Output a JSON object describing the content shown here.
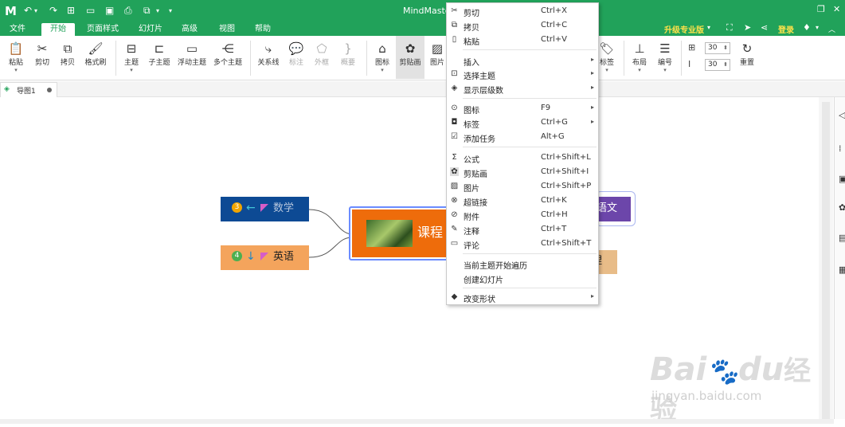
{
  "app": {
    "title": "MindMaster",
    "logo": "M"
  },
  "titlebar": {
    "upgrade_label": "升级专业版",
    "login_label": "登录"
  },
  "tabs": [
    {
      "label": "文件"
    },
    {
      "label": "开始"
    },
    {
      "label": "页面样式"
    },
    {
      "label": "幻灯片"
    },
    {
      "label": "高级"
    },
    {
      "label": "视图"
    },
    {
      "label": "帮助"
    }
  ],
  "ribbon": {
    "buttons": [
      {
        "label": "粘贴",
        "icon": "clipboard-icon"
      },
      {
        "label": "剪切",
        "icon": "scissors-icon"
      },
      {
        "label": "拷贝",
        "icon": "copy-icon"
      },
      {
        "label": "格式刷",
        "icon": "format-brush-icon"
      },
      {
        "label": "主题",
        "icon": "topic-icon"
      },
      {
        "label": "子主题",
        "icon": "subtopic-icon"
      },
      {
        "label": "浮动主题",
        "icon": "floating-topic-icon"
      },
      {
        "label": "多个主题",
        "icon": "multiple-topics-icon"
      },
      {
        "label": "关系线",
        "icon": "relationship-icon"
      },
      {
        "label": "标注",
        "icon": "callout-icon"
      },
      {
        "label": "外框",
        "icon": "boundary-icon"
      },
      {
        "label": "概要",
        "icon": "summary-icon"
      },
      {
        "label": "图标",
        "icon": "icon-icon"
      },
      {
        "label": "剪贴画",
        "icon": "clipart-icon"
      },
      {
        "label": "图片",
        "icon": "picture-icon"
      },
      {
        "label": "标签",
        "icon": "tag-icon"
      },
      {
        "label": "布局",
        "icon": "layout-icon"
      },
      {
        "label": "编号",
        "icon": "numbering-icon"
      },
      {
        "label": "重置",
        "icon": "reset-icon"
      }
    ],
    "spacing_h": "30",
    "spacing_v": "30"
  },
  "doc_tab": {
    "label": "导图1"
  },
  "mindmap": {
    "central": "课程",
    "left_topics": [
      {
        "label": "数学",
        "badge": "3",
        "badge_color": "#f0a500",
        "arrow": "←"
      },
      {
        "label": "英语",
        "badge": "4",
        "badge_color": "#4caf50",
        "arrow": "↓"
      }
    ],
    "right_topics": [
      {
        "label": "语文"
      },
      {
        "label": "理"
      }
    ]
  },
  "context_menu": {
    "items": [
      {
        "label": "剪切",
        "shortcut": "Ctrl+X",
        "icon": "scissors-icon"
      },
      {
        "label": "拷贝",
        "shortcut": "Ctrl+C",
        "icon": "copy-icon"
      },
      {
        "label": "粘贴",
        "shortcut": "Ctrl+V",
        "icon": "clipboard-icon"
      },
      {
        "label": "插入",
        "shortcut": "",
        "icon": ""
      },
      {
        "label": "选择主题",
        "shortcut": "",
        "icon": "select-topic-icon"
      },
      {
        "label": "显示层级数",
        "shortcut": "",
        "icon": "layers-icon"
      },
      {
        "label": "图标",
        "shortcut": "F9",
        "icon": "icon-icon"
      },
      {
        "label": "标签",
        "shortcut": "Ctrl+G",
        "icon": "tag-icon"
      },
      {
        "label": "添加任务",
        "shortcut": "Alt+G",
        "icon": "task-icon"
      },
      {
        "label": "公式",
        "shortcut": "Ctrl+Shift+L",
        "icon": "formula-icon"
      },
      {
        "label": "剪贴画",
        "shortcut": "Ctrl+Shift+I",
        "icon": "clipart-icon"
      },
      {
        "label": "图片",
        "shortcut": "Ctrl+Shift+P",
        "icon": "picture-icon"
      },
      {
        "label": "超链接",
        "shortcut": "Ctrl+K",
        "icon": "hyperlink-icon"
      },
      {
        "label": "附件",
        "shortcut": "Ctrl+H",
        "icon": "attachment-icon"
      },
      {
        "label": "注释",
        "shortcut": "Ctrl+T",
        "icon": "note-icon"
      },
      {
        "label": "评论",
        "shortcut": "Ctrl+Shift+T",
        "icon": "comment-icon"
      },
      {
        "label": "当前主题开始遍历",
        "shortcut": "",
        "icon": ""
      },
      {
        "label": "创建幻灯片",
        "shortcut": "",
        "icon": ""
      },
      {
        "label": "改变形状",
        "shortcut": "",
        "icon": "shape-icon"
      }
    ]
  },
  "colors": {
    "accent_green": "#21a25a",
    "central_orange": "#ee6c0b",
    "math_navy": "#0d4a94",
    "english_orange": "#f4a45c",
    "chinese_purple": "#6c46aa",
    "pointer_red": "#e8412c"
  },
  "watermark": {
    "brand": "Bai",
    "brand_du": "du",
    "brand_cn": "经验",
    "url": "jingyan.baidu.com"
  }
}
